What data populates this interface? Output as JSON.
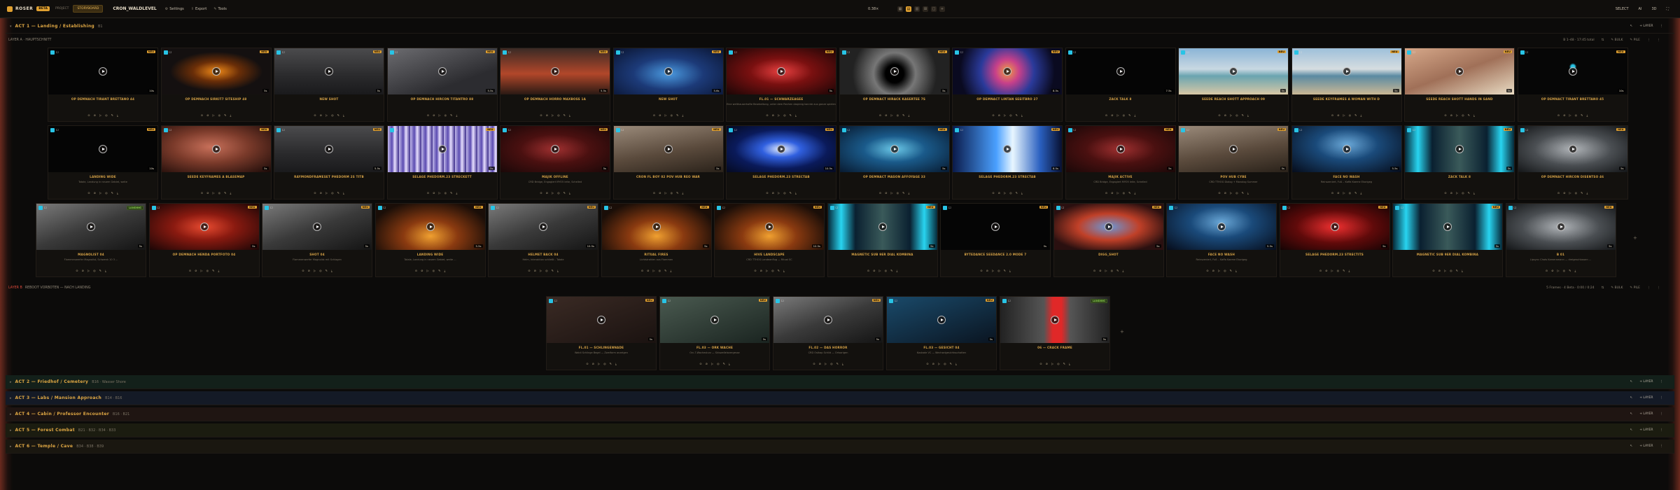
{
  "topbar": {
    "app_name": "ROSER",
    "badge": "BETA",
    "crumbs": [
      "PROJECT",
      "STORYBOARD"
    ],
    "project": "CRON_WALDLEVEL",
    "menu": [
      {
        "icon": "⚙",
        "label": "Settings"
      },
      {
        "icon": "⇪",
        "label": "Export"
      },
      {
        "icon": "✎",
        "label": "Tools"
      }
    ],
    "zoom": "0.38×",
    "view_toggles": [
      "▦",
      "▤",
      "▥",
      "⊞",
      "□",
      "+"
    ],
    "right": [
      "SELECT",
      "AI",
      "3D",
      "⛶"
    ]
  },
  "act1": {
    "title": "ACT 1 — Landing / Establishing",
    "sub": "B1",
    "tools": [
      "↖",
      "+ LAYER",
      "⋮"
    ]
  },
  "layerA": {
    "label": "LAYER A · HAUPTSCHNITT",
    "right": [
      "B 1–48 · 17:45 total",
      "⇅",
      "✎ BULK",
      "✎ PILE",
      "⋮",
      "⋮"
    ]
  },
  "layerB": {
    "label": "LAYER B",
    "sub": "REBOOT VORBOTEN — NACH LANDING",
    "right": [
      "5 Frames · 4 Beta · 0:00 / 0:24",
      "⇅",
      "✎ BULK",
      "✎ PILE",
      "⋮",
      "⋮"
    ]
  },
  "clip_actions": [
    "⊙",
    "⊘",
    "▷",
    "◎",
    "✎",
    "⤓"
  ],
  "row1": [
    {
      "t": "t-black",
      "title": "OP DEMNACH TIRANT BRETTANO 44",
      "desc": "",
      "tag": "NEU",
      "dur": "10s"
    },
    {
      "t": "t-orange",
      "title": "OP DEMNACH SIRKIT7 SITESHIP 48",
      "desc": "",
      "tag": "NEU",
      "dur": "5s"
    },
    {
      "t": "t-soldier",
      "title": "NEW SHOT",
      "desc": "",
      "tag": "NEU",
      "dur": "5s"
    },
    {
      "t": "t-grey",
      "title": "OP DEMNACH HIRCON TITANTRO 88",
      "desc": "",
      "tag": "NEU",
      "dur": "5.5s"
    },
    {
      "t": "t-fire",
      "title": "OP DEMNACH HORRO MAXBOSS 1A",
      "desc": "",
      "tag": "NEU",
      "dur": "5.5s"
    },
    {
      "t": "t-blue",
      "title": "NEW SHOT",
      "desc": "",
      "tag": "NEU",
      "dur": "5.6s"
    },
    {
      "t": "t-red",
      "title": "FL.01 — SCHWARZEAGEE",
      "desc": "Eine welthauserhafte Bearbeitung, unter dem Rechen dasjenig kannte aus ganze spielen ...",
      "tag": "NEU",
      "dur": "5s"
    },
    {
      "t": "t-hole",
      "title": "OP DEMNACT HIRACK KASERTEE 7S",
      "desc": "",
      "tag": "NEU",
      "dur": "5s"
    },
    {
      "t": "t-nebula",
      "title": "OP DEMNACT LINTAN SEEITBRO 27",
      "desc": "",
      "tag": "NEU",
      "dur": "8.5s"
    },
    {
      "t": "t-black",
      "title": "ZACK TALK 8",
      "desc": "",
      "tag": "",
      "dur": "7.5s"
    },
    {
      "t": "t-beach",
      "title": "SEEDE REACH SHOTT APPROACH 09",
      "desc": "",
      "tag": "NEU",
      "dur": "5s"
    },
    {
      "t": "t-beach2",
      "title": "SEEDE KEYFRAMES A WOMAN WITH D",
      "desc": "",
      "tag": "NEU",
      "dur": "5s"
    },
    {
      "t": "t-hands",
      "title": "SEEDE REACH SHOTT HANDS IN SAND",
      "desc": "",
      "tag": "NEU",
      "dur": "5s"
    },
    {
      "t": "t-dot",
      "title": "OP DEMNACT TIRANT BRETTANO 45",
      "desc": "",
      "tag": "NEU",
      "dur": "10s"
    }
  ],
  "row2": [
    {
      "t": "t-black",
      "title": "LANDING WIDE",
      "desc": "Totale, Landung in neuem Gebiet, weite",
      "tag": "NEU",
      "dur": "10s"
    },
    {
      "t": "t-face",
      "title": "SEEDE KEYFRAMES A BLASEMAP",
      "desc": "",
      "tag": "NEU",
      "dur": "5s"
    },
    {
      "t": "t-soldier",
      "title": "RAYMONDFRAMESET PHEDORM 2S TITB",
      "desc": "",
      "tag": "NEU",
      "dur": "5.5s"
    },
    {
      "t": "t-stripe",
      "title": "SELAGE PHEDORM.23 STRECKETT",
      "desc": "",
      "tag": "NEU",
      "dur": "5s"
    },
    {
      "t": "t-demon",
      "title": "MAJIK OFFLINE",
      "desc": "CRD Bridge, Engagiert MYO5 leite, Schelled",
      "tag": "NEU",
      "dur": "5s"
    },
    {
      "t": "t-rock",
      "title": "CRON FL BOY 02 POV HUB REO WAR",
      "desc": "",
      "tag": "NEU",
      "dur": "5s"
    },
    {
      "t": "t-eye",
      "title": "SELAGE PHEDORM.23 STRECTAB",
      "desc": "",
      "tag": "NEU",
      "dur": "10.5s"
    },
    {
      "t": "t-lake",
      "title": "OP DEMNACT MASON AFFOYAGE 33",
      "desc": "",
      "tag": "NEU",
      "dur": "5s"
    },
    {
      "t": "t-beam",
      "title": "SELAGE PHEDORM.23 STRECTAB",
      "desc": "",
      "tag": "NEU",
      "dur": "8.5s"
    },
    {
      "t": "t-demon",
      "title": "MAJIK ACTIVE",
      "desc": "CRD Bridge, Engagiert MYO5 leite, Schelled",
      "tag": "NEU",
      "dur": "5s"
    },
    {
      "t": "t-rock",
      "title": "POV HUB CYBE",
      "desc": "CRD TTHOG Dialog + Monolog Summer",
      "tag": "NEU",
      "dur": "5s"
    },
    {
      "t": "t-bluefx",
      "title": "FACE NO WASH",
      "desc": "Reinszeniert, Fuß .. Kaffa Kaeme Ekorigeg",
      "tag": "",
      "dur": "5.5s"
    },
    {
      "t": "t-neon",
      "title": "ZACK TALK 8",
      "desc": "",
      "tag": "NEU",
      "dur": "5s"
    },
    {
      "t": "t-pale",
      "title": "OP DEMNACT HIRCON DISENTSO 46",
      "desc": "",
      "tag": "NEU",
      "dur": "5s"
    }
  ],
  "row3": [
    {
      "t": "t-claw",
      "title": "MAGNOLIST 04",
      "desc": "Flammenwerfer Magnolist, Schwenk 10 3 ...",
      "tag": "LANDING",
      "tagc": "green",
      "dur": "5s"
    },
    {
      "t": "t-redhand",
      "title": "OP DEMNACH HENDA PORTFOTO 04",
      "desc": "",
      "tag": "NEU",
      "dur": "5s"
    },
    {
      "t": "t-claw",
      "title": "SHOT 04",
      "desc": "Flammenwerfer Magnolist mit Schlagen",
      "tag": "NEU",
      "dur": "5s"
    },
    {
      "t": "t-ember",
      "title": "LANDING WIDE",
      "desc": "Totale, Landung in neuem Gebiet, weite ...",
      "tag": "NEU",
      "dur": "5.5s"
    },
    {
      "t": "t-claw",
      "title": "HELMET BACK 04",
      "desc": "Helm, Interaktion schließt - Totale",
      "tag": "NEU",
      "dur": "10.5s"
    },
    {
      "t": "t-ember",
      "title": "RITUAL FIRES",
      "desc": "Lichtstrahlen aus Flammen",
      "tag": "NEU",
      "dur": "5s"
    },
    {
      "t": "t-ember",
      "title": "HIVE LANDSCAPE",
      "desc": "CRD TTHOG Landeanflug — Ritual SC",
      "tag": "NEU",
      "dur": "10.5s"
    },
    {
      "t": "t-neon",
      "title": "MAGNETIC SUB 9ER DIAL KOMBINA",
      "desc": "",
      "tag": "NEU",
      "dur": "5s"
    },
    {
      "t": "t-black",
      "title": "BYTEDANCE SEEDANCE 2.0 MODE 7",
      "desc": "",
      "tag": "NEU",
      "dur": "5s"
    },
    {
      "t": "t-blob",
      "title": "DIGG_SHOT",
      "desc": "",
      "tag": "NEU",
      "dur": "5s"
    },
    {
      "t": "t-bluefx",
      "title": "FACE NO WASH",
      "desc": "Reinszeniert, Fuß .. Kaffa Kaeme Ekorigeg",
      "tag": "",
      "dur": "5.5s"
    },
    {
      "t": "t-red2",
      "title": "SELAGE PHEDORM.23 STRECTITS",
      "desc": "",
      "tag": "NEU",
      "dur": "5s"
    },
    {
      "t": "t-neon",
      "title": "MAGNETIC SUB 9ER DIAL KOMBINA",
      "desc": "",
      "tag": "NEU",
      "dur": "5s"
    },
    {
      "t": "t-pale",
      "title": "B 01",
      "desc": "Lipsync Chats Kameramann — dreigeschlossen ...",
      "tag": "NEU",
      "dur": "5s"
    }
  ],
  "rowB": [
    {
      "t": "t-dark",
      "title": "FL.01 — SCHLINGENNADE",
      "desc": "Waldi Schlinge Begel — Zweiform anzeigen",
      "tag": "NEU",
      "dur": "5s"
    },
    {
      "t": "t-forest",
      "title": "FL.03 — ORK WACHE",
      "desc": "Orc-?-Wachesturz — Skiswellelavergesse",
      "tag": "NEU",
      "dur": "5s"
    },
    {
      "t": "t-claw",
      "title": "FL.02 — DAS HORROR",
      "desc": "CRD Ostkap Schild — Ortsorigen",
      "tag": "NEU",
      "dur": "5s"
    },
    {
      "t": "t-cold",
      "title": "FL.03 — GESICHT 04",
      "desc": "Kaskade VC — Wechselgesichtsschatten",
      "tag": "NEU",
      "dur": "5s"
    },
    {
      "t": "t-redbar",
      "title": "06 — CRACK FRAME",
      "desc": "",
      "tag": "LANDING",
      "tagc": "green",
      "dur": "5s"
    }
  ],
  "collapsed_acts": [
    {
      "title": "ACT 2 — Friedhof / Cemetery",
      "sub": "B16 · Wasser Shore",
      "tools": [
        "↖",
        "+ LAYER",
        "⋮"
      ]
    },
    {
      "title": "ACT 3 — Labs / Mansion Approach",
      "sub": "B14 · B16",
      "tools": [
        "↖",
        "+ LAYER",
        "⋮"
      ]
    },
    {
      "title": "ACT 4 — Cabin / Professor Encounter",
      "sub": "B16 · B21",
      "tools": [
        "↖",
        "+ LAYER",
        "⋮"
      ]
    },
    {
      "title": "ACT 5 — Forest Combat",
      "sub": "B21 · B32 · B34 · B33",
      "tools": [
        "↖",
        "+ LAYER",
        "⋮"
      ]
    },
    {
      "title": "ACT 6 — Temple / Cave",
      "sub": "B34 · B38 · B39",
      "tools": [
        "↖",
        "+ LAYER",
        "⋮"
      ]
    }
  ],
  "add_label": "+"
}
